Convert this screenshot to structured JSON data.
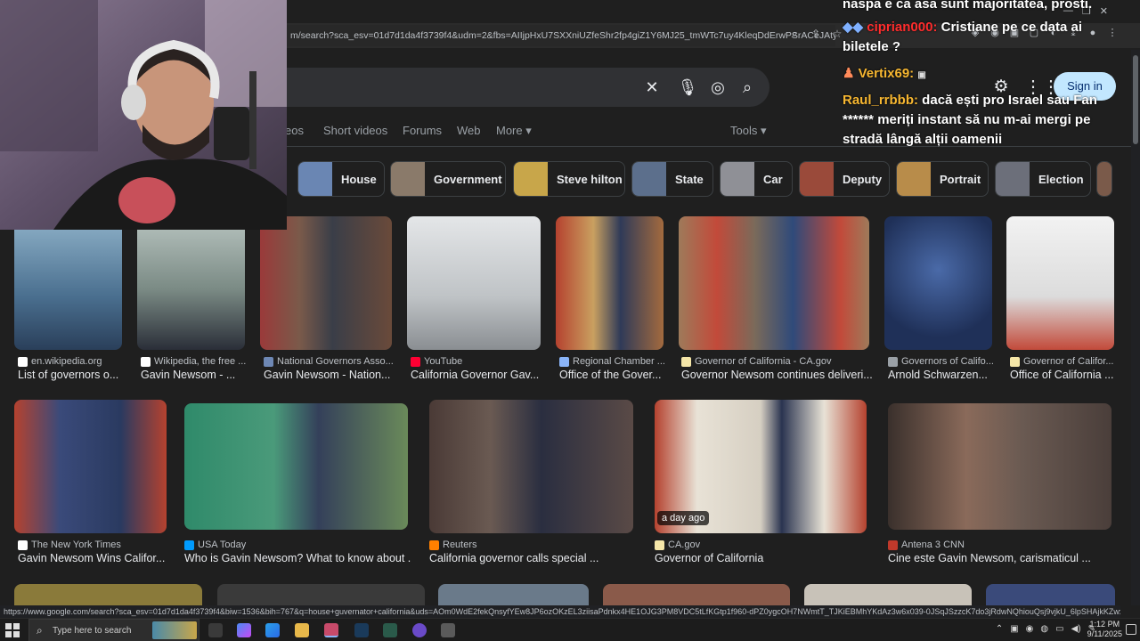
{
  "browser": {
    "url": "m/search?sca_esv=01d7d1da4f3739f4&udm=2&fbs=AIIjpHxU7SXXniUZfeShr2fp4giZ1Y6MJ25_tmWTc7uy4KleqDdErwPSrACeJAty2zA...",
    "status_url": "https://www.google.com/search?sca_esv=01d7d1da4f3739f4&biw=1536&bih=767&q=house+guvernator+california&uds=AOm0WdE2fekQnsyfYEw8JP6ozOKzEL3ziisaPdnkx4HE1OJG3PM8VDC5tLfKGtp1f960-dPZ0ygcOH7NWmtT_TJKiEBMhYKdAz3w6x039-0JSqJSzzcK7do3jRdwNQhiouQsj9vjkU_6lpSHAjkKZwxPNMWGG12tVS6d69DasQA4PSehFAoczl&ud..."
  },
  "header": {
    "signin_label": "Sign in"
  },
  "tabs": [
    {
      "label": "eos"
    },
    {
      "label": "Short videos"
    },
    {
      "label": "Forums"
    },
    {
      "label": "Web"
    },
    {
      "label": "More ▾"
    }
  ],
  "tools_label": "Tools ▾",
  "chips": [
    {
      "label": "House",
      "color": "#6a86b3"
    },
    {
      "label": "Government",
      "color": "#8a7a6a"
    },
    {
      "label": "Steve hilton",
      "color": "#c8a64a"
    },
    {
      "label": "State",
      "color": "#5c6f8c"
    },
    {
      "label": "Car",
      "color": "#8f9096"
    },
    {
      "label": "Deputy",
      "color": "#9a4a3a"
    },
    {
      "label": "Portrait",
      "color": "#b88c4a"
    },
    {
      "label": "Election",
      "color": "#6c6f7a"
    }
  ],
  "row1": [
    {
      "source": "en.wikipedia.org",
      "title": "List of governors o...",
      "fav": "#ffffff",
      "bg": "#6c8ba6"
    },
    {
      "source": "Wikipedia, the free ...",
      "title": "Gavin Newsom - ...",
      "fav": "#ffffff",
      "bg": "#9aa5a0"
    },
    {
      "source": "National Governors Asso...",
      "title": "Gavin Newsom - Nation...",
      "fav": "#6e88b5",
      "bg": "#8a6a5a"
    },
    {
      "source": "YouTube",
      "title": "California Governor Gav...",
      "fav": "#ff0033",
      "bg": "#c8ccd0"
    },
    {
      "source": "Regional Chamber ...",
      "title": "Office of the Gover...",
      "fav": "#8ab4f8",
      "bg": "#a36a3e"
    },
    {
      "source": "Governor of California - CA.gov",
      "title": "Governor Newsom continues deliveri...",
      "fav": "#f5e6a8",
      "bg": "#9e7a5a"
    },
    {
      "source": "Governors of Califo...",
      "title": "Arnold Schwarzen...",
      "fav": "#9aa0a6",
      "bg": "#2f4a7a"
    },
    {
      "source": "Governor of Califor...",
      "title": "Office of California ...",
      "fav": "#f5e6a8",
      "bg": "#dcdcdc"
    }
  ],
  "row2": [
    {
      "source": "The New York Times",
      "title": "Gavin Newsom Wins Califor...",
      "fav": "#ffffff",
      "bg": "#5a6a8a"
    },
    {
      "source": "USA Today",
      "title": "Who is Gavin Newsom? What to know about ...",
      "fav": "#009bff",
      "bg": "#4a8a6a"
    },
    {
      "source": "Reuters",
      "title": "California governor calls special ...",
      "fav": "#ff8000",
      "bg": "#5a4a46"
    },
    {
      "source": "CA.gov",
      "title": "Governor of California",
      "fav": "#f5e6a8",
      "bg": "#c8beb0",
      "badge": "a day ago"
    },
    {
      "source": "Antena 3 CNN",
      "title": "Cine este Gavin Newsom, carismaticul ...",
      "fav": "#c0392b",
      "bg": "#6a5a52"
    }
  ],
  "chat": [
    {
      "user": "",
      "text": "naspa e ca asa sunt majoritatea, prosti.",
      "ucolor": "#ffffff"
    },
    {
      "user": "ciprian000:",
      "text": " Cristiane pe ce data ai biletele ?",
      "ucolor": "#ff2d2d"
    },
    {
      "user": "Vertix69:",
      "text": "",
      "ucolor": "#f7b731"
    },
    {
      "user": "Raul_rrbbb:",
      "text": " dacă ești pro Israel sau Fan ****** meriți instant să nu m-ai mergi pe stradă lângă alții oamenii",
      "ucolor": "#f7b731"
    }
  ],
  "taskbar": {
    "search_placeholder": "Type here to search",
    "time": "1:12 PM",
    "date": "9/11/2025"
  },
  "colors": {
    "background": "#1f1f1f",
    "signin_bg": "#c2e7ff",
    "chip_border": "#3c4043"
  }
}
